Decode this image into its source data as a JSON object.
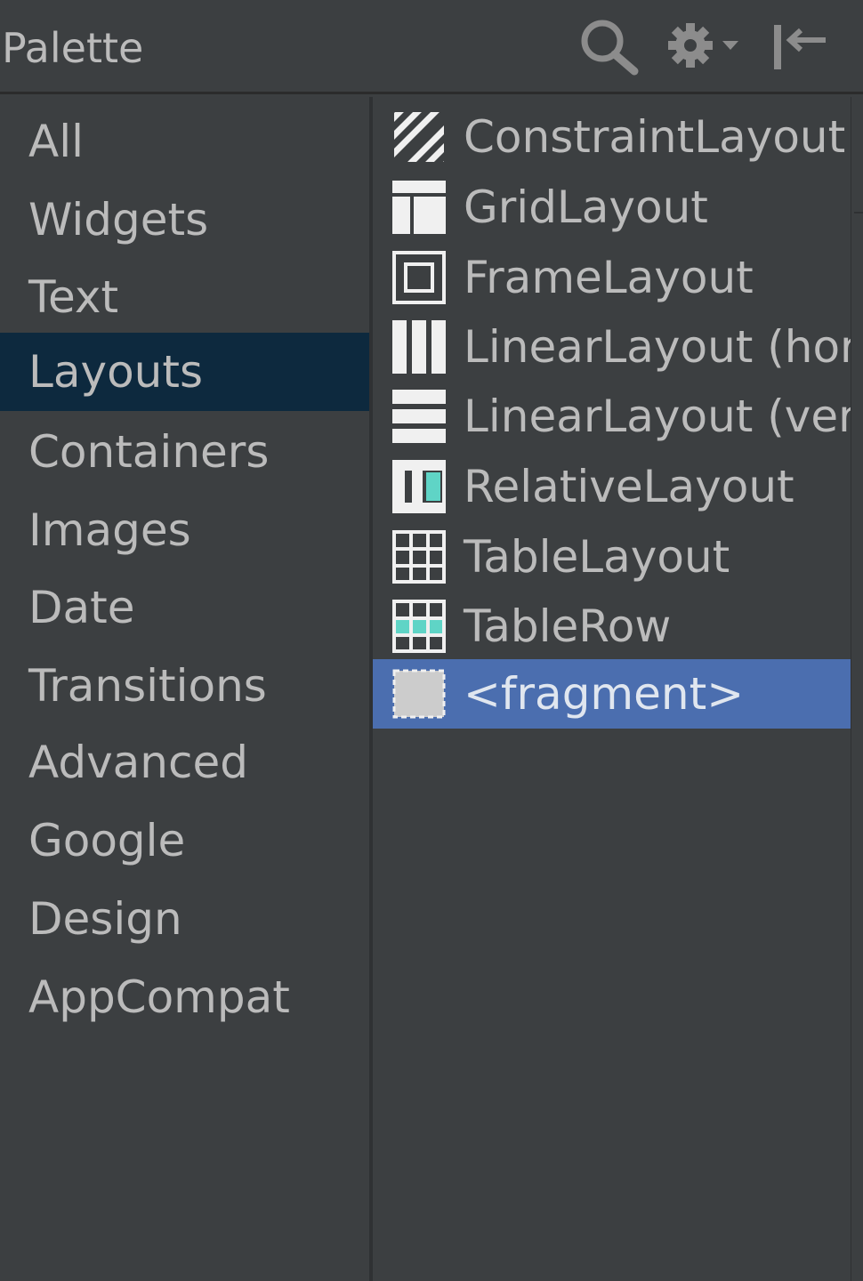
{
  "header": {
    "title": "Palette",
    "icons": [
      "search-icon",
      "gear-icon",
      "collapse-left-icon"
    ]
  },
  "categories": [
    {
      "label": "All",
      "selected": false
    },
    {
      "label": "Widgets",
      "selected": false
    },
    {
      "label": "Text",
      "selected": false
    },
    {
      "label": "Layouts",
      "selected": true
    },
    {
      "label": "Containers",
      "selected": false
    },
    {
      "label": "Images",
      "selected": false
    },
    {
      "label": "Date",
      "selected": false
    },
    {
      "label": "Transitions",
      "selected": false
    },
    {
      "label": "Advanced",
      "selected": false
    },
    {
      "label": "Google",
      "selected": false
    },
    {
      "label": "Design",
      "selected": false
    },
    {
      "label": "AppCompat",
      "selected": false
    }
  ],
  "components": [
    {
      "label": "ConstraintLayout",
      "icon": "constraint-layout-icon",
      "selected": false
    },
    {
      "label": "GridLayout",
      "icon": "grid-layout-icon",
      "selected": false
    },
    {
      "label": "FrameLayout",
      "icon": "frame-layout-icon",
      "selected": false
    },
    {
      "label": "LinearLayout (horiz",
      "icon": "linear-horizontal-icon",
      "selected": false
    },
    {
      "label": "LinearLayout (verti",
      "icon": "linear-vertical-icon",
      "selected": false
    },
    {
      "label": "RelativeLayout",
      "icon": "relative-layout-icon",
      "selected": false
    },
    {
      "label": "TableLayout",
      "icon": "table-layout-icon",
      "selected": false
    },
    {
      "label": "TableRow",
      "icon": "table-row-icon",
      "selected": false
    },
    {
      "label": "<fragment>",
      "icon": "fragment-icon",
      "selected": true
    }
  ],
  "colors": {
    "background": "#3c3f41",
    "text": "#bbbbbb",
    "category_selected": "#0d293e",
    "component_selected": "#4b6eaf",
    "icon_fill": "#f0f0f0",
    "icon_accent": "#5fd4c6"
  }
}
